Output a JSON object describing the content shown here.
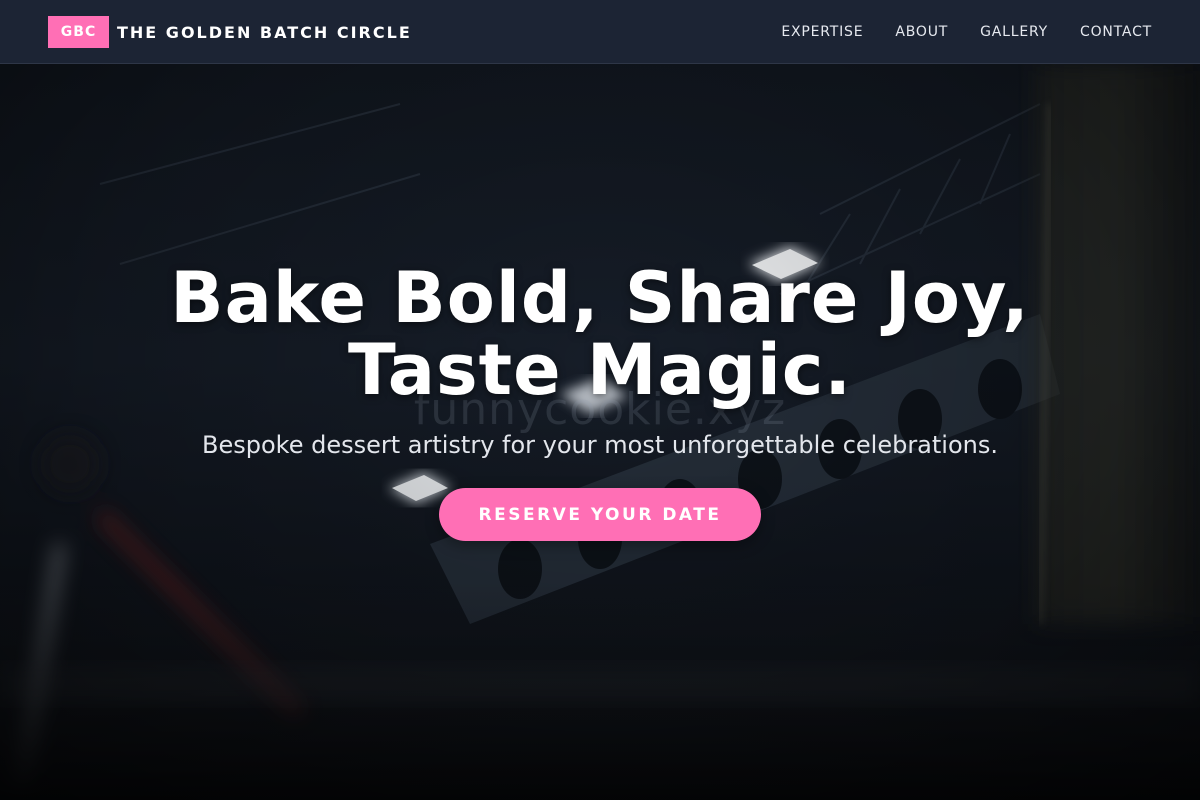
{
  "brand": {
    "badge": "GBC",
    "name": "THE GOLDEN BATCH CIRCLE"
  },
  "nav": {
    "links": [
      {
        "label": "EXPERTISE"
      },
      {
        "label": "ABOUT"
      },
      {
        "label": "GALLERY"
      },
      {
        "label": "CONTACT"
      }
    ]
  },
  "hero": {
    "title_line1": "Bake Bold, Share Joy,",
    "title_line2": "Taste Magic.",
    "subtitle": "Bespoke dessert artistry for your most unforgettable celebrations.",
    "cta_label": "RESERVE YOUR DATE",
    "watermark": "funnycookie.xyz"
  },
  "colors": {
    "accent": "#ff6fb5",
    "navbar_bg": "#1c2434",
    "hero_text": "#ffffff"
  },
  "icons": {
    "hero_background": "dark-industrial-lights-photo"
  }
}
